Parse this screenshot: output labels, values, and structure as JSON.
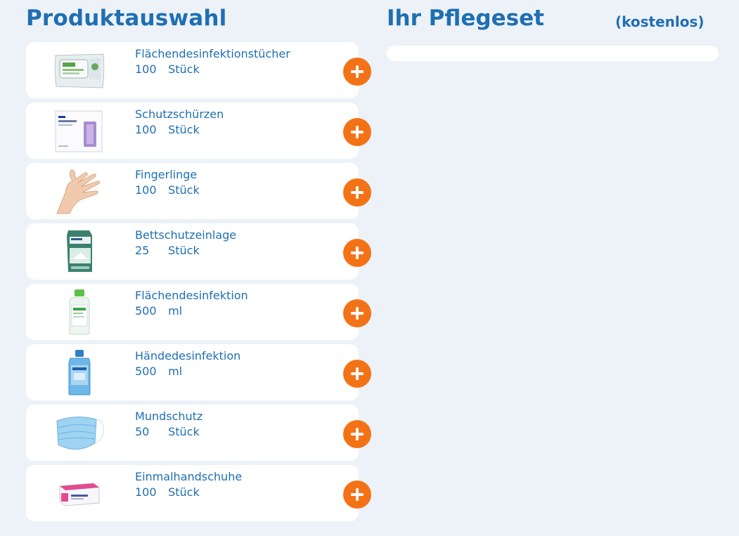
{
  "selection": {
    "title": "Produktauswahl",
    "products": [
      {
        "name": "Flächendesinfektionstücher",
        "amount": "100",
        "unit": "Stück",
        "image_icon": "wipes-pack-icon"
      },
      {
        "name": "Schutzschürzen",
        "amount": "100",
        "unit": "Stück",
        "image_icon": "apron-box-icon"
      },
      {
        "name": "Fingerlinge",
        "amount": "100",
        "unit": "Stück",
        "image_icon": "glove-hand-icon"
      },
      {
        "name": "Bettschutzeinlage",
        "amount": "25",
        "unit": "Stück",
        "image_icon": "bed-pad-pack-icon"
      },
      {
        "name": "Flächendesinfektion",
        "amount": "500",
        "unit": "ml",
        "image_icon": "green-bottle-icon"
      },
      {
        "name": "Händedesinfektion",
        "amount": "500",
        "unit": "ml",
        "image_icon": "blue-bottle-icon"
      },
      {
        "name": "Mundschutz",
        "amount": "50",
        "unit": "Stück",
        "image_icon": "face-mask-icon"
      },
      {
        "name": "Einmalhandschuhe",
        "amount": "100",
        "unit": "Stück",
        "image_icon": "glove-box-icon"
      }
    ],
    "add_icon": "plus-icon"
  },
  "care_set": {
    "title": "Ihr Pflegeset",
    "price_note": "(kostenlos)"
  },
  "colors": {
    "brand_blue": "#1f6fb2",
    "accent_orange": "#f47216",
    "background": "#edf2f9",
    "card": "#ffffff"
  }
}
